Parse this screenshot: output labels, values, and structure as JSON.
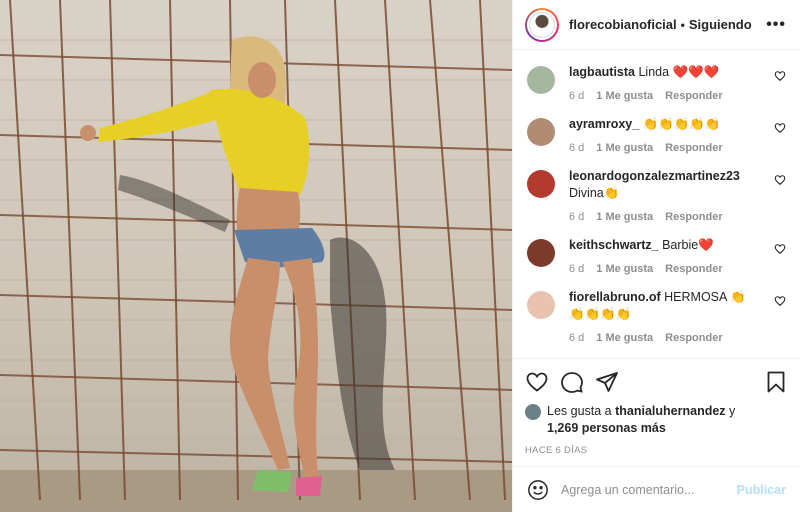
{
  "header": {
    "username": "florecobianoficial",
    "separator": "•",
    "follow_status": "Siguiendo",
    "more": "•••"
  },
  "comments": [
    {
      "user": "lagbautista",
      "text": " Linda ❤️❤️❤️",
      "time": "6 d",
      "likes": "1 Me gusta",
      "reply": "Responder",
      "avatar_color": "#a6b7a0"
    },
    {
      "user": "ayramroxy_",
      "text": " 👏👏👏👏👏",
      "time": "6 d",
      "likes": "1 Me gusta",
      "reply": "Responder",
      "avatar_color": "#b08c74"
    },
    {
      "user": "leonardogonzalezmartinez23",
      "text": " Divina👏",
      "time": "6 d",
      "likes": "1 Me gusta",
      "reply": "Responder",
      "avatar_color": "#b23a2f"
    },
    {
      "user": "keithschwartz_",
      "text": " Barbie❤️",
      "time": "6 d",
      "likes": "1 Me gusta",
      "reply": "Responder",
      "avatar_color": "#7a3b2c"
    },
    {
      "user": "fiorellabruno.of",
      "text": " HERMOSA 👏 👏👏👏👏",
      "time": "6 d",
      "likes": "1 Me gusta",
      "reply": "Responder",
      "avatar_color": "#e8c3b0"
    }
  ],
  "likes": {
    "prefix": "Les gusta a ",
    "user": "thanialuhernandez",
    "joiner": " y",
    "count": "1,269 personas más"
  },
  "time_ago": "HACE 6 DÍAS",
  "add_comment": {
    "placeholder": "Agrega un comentario...",
    "post_label": "Publicar"
  },
  "colors": {
    "accent_disabled": "#b2dffc",
    "muted": "#8e8e8e",
    "border": "#efefef"
  },
  "icons": [
    "heart-icon",
    "comment-icon",
    "share-icon",
    "bookmark-icon",
    "emoji-icon",
    "more-icon"
  ]
}
